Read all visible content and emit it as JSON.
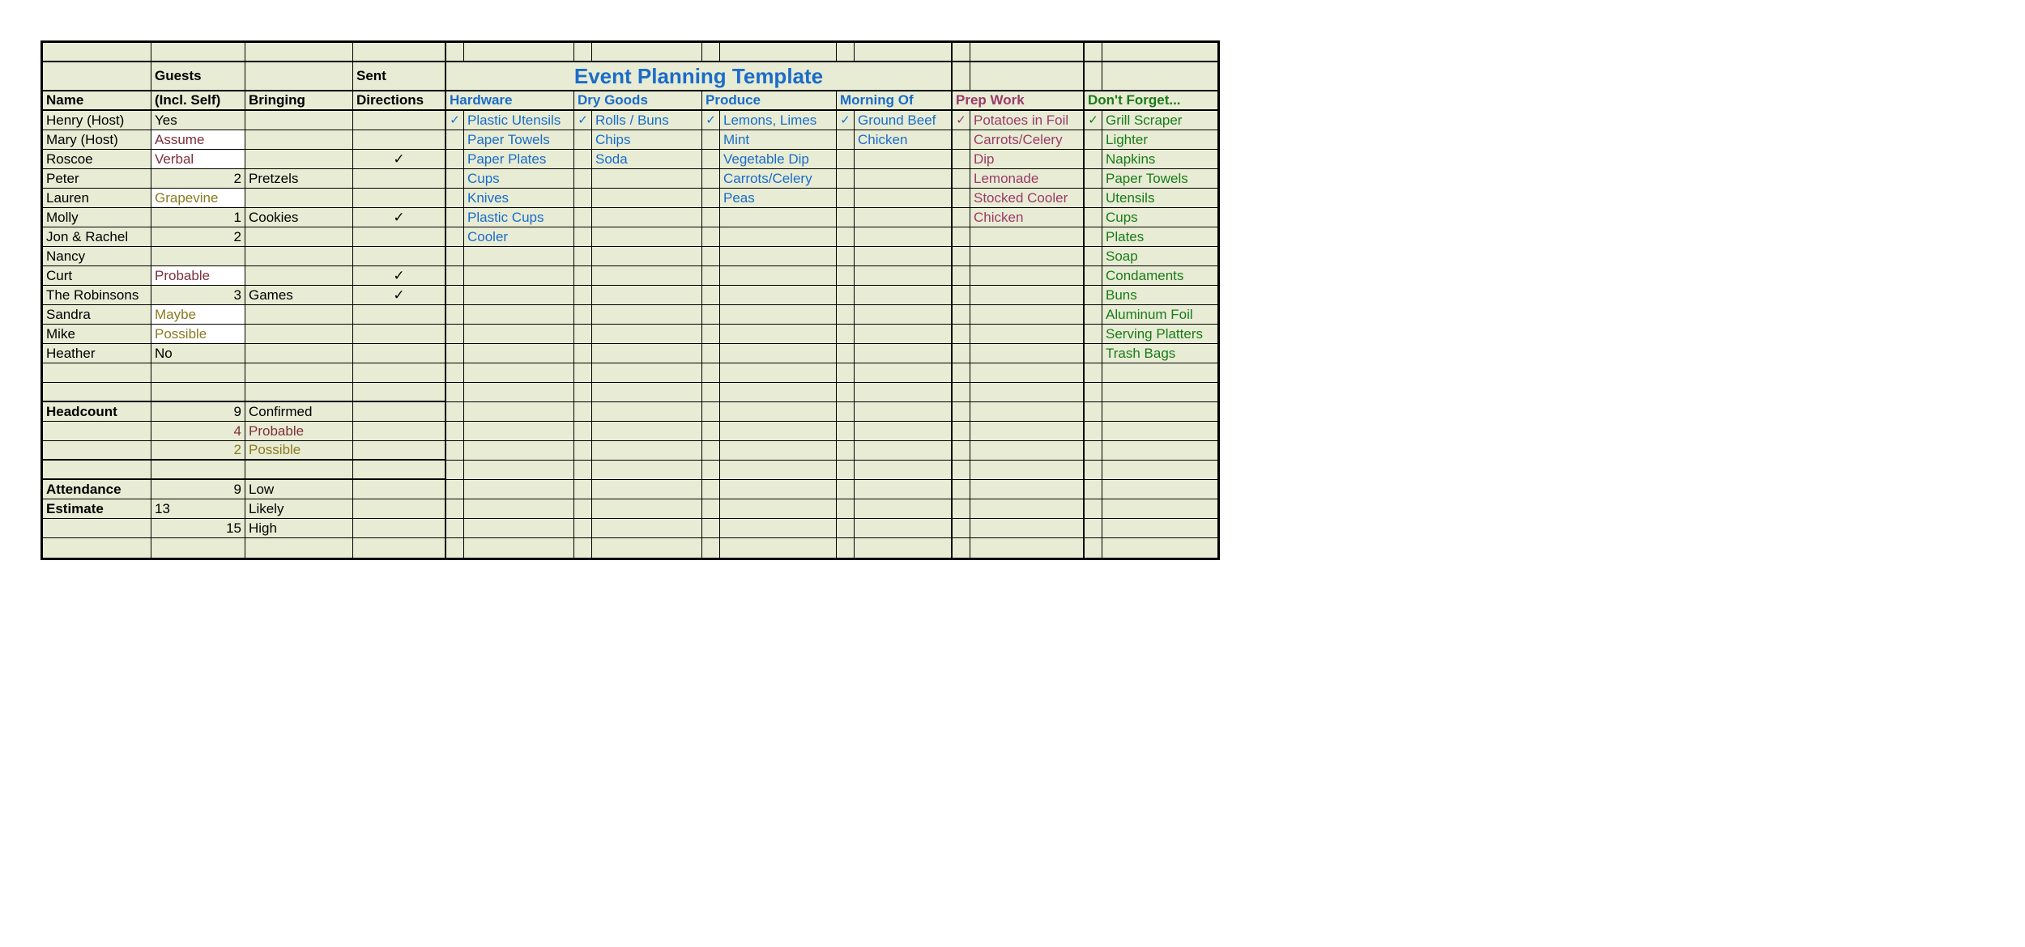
{
  "title": "Event Planning Template",
  "headers": {
    "guests": "Guests",
    "sent": "Sent",
    "name": "Name",
    "incl_self": "(Incl. Self)",
    "bringing": "Bringing",
    "directions": "Directions",
    "hardware": "Hardware",
    "dry_goods": "Dry Goods",
    "produce": "Produce",
    "morning_of": "Morning Of",
    "prep_work": "Prep Work",
    "dont_forget": "Don't Forget..."
  },
  "guests": [
    {
      "name": "Henry (Host)",
      "incl": "Yes",
      "incl_style": "",
      "bringing": "",
      "dir": ""
    },
    {
      "name": "Mary (Host)",
      "incl": "Assume",
      "incl_style": "maroon white",
      "bringing": "",
      "dir": ""
    },
    {
      "name": "Roscoe",
      "incl": "Verbal",
      "incl_style": "maroon white",
      "bringing": "",
      "dir": "✓"
    },
    {
      "name": "Peter",
      "incl": "2",
      "incl_style": "right",
      "bringing": "Pretzels",
      "dir": ""
    },
    {
      "name": "Lauren",
      "incl": "Grapevine",
      "incl_style": "olive white",
      "bringing": "",
      "dir": ""
    },
    {
      "name": "Molly",
      "incl": "1",
      "incl_style": "right",
      "bringing": "Cookies",
      "dir": "✓"
    },
    {
      "name": "Jon & Rachel",
      "incl": "2",
      "incl_style": "right",
      "bringing": "",
      "dir": ""
    },
    {
      "name": "Nancy",
      "incl": "",
      "incl_style": "",
      "bringing": "",
      "dir": ""
    },
    {
      "name": "Curt",
      "incl": "Probable",
      "incl_style": "maroon white",
      "bringing": "",
      "dir": "✓"
    },
    {
      "name": "The Robinsons",
      "incl": "3",
      "incl_style": "right",
      "bringing": "Games",
      "dir": "✓"
    },
    {
      "name": "Sandra",
      "incl": "Maybe",
      "incl_style": "olive white",
      "bringing": "",
      "dir": ""
    },
    {
      "name": "Mike",
      "incl": "Possible",
      "incl_style": "olive white",
      "bringing": "",
      "dir": ""
    },
    {
      "name": "Heather",
      "incl": "No",
      "incl_style": "",
      "bringing": "",
      "dir": ""
    }
  ],
  "hardware": [
    "Plastic Utensils",
    "Paper Towels",
    "Paper Plates",
    "Cups",
    "Knives",
    "Plastic Cups",
    "Cooler",
    "",
    "",
    "",
    "",
    "",
    ""
  ],
  "dry_goods": [
    "Rolls / Buns",
    "Chips",
    "Soda",
    "",
    "",
    "",
    "",
    "",
    "",
    "",
    "",
    "",
    ""
  ],
  "produce": [
    "Lemons, Limes",
    "Mint",
    "Vegetable Dip",
    "Carrots/Celery",
    "Peas",
    "",
    "",
    "",
    "",
    "",
    "",
    "",
    ""
  ],
  "morning_of": [
    "Ground Beef",
    "Chicken",
    "",
    "",
    "",
    "",
    "",
    "",
    "",
    "",
    "",
    "",
    ""
  ],
  "prep_work": [
    "Potatoes in Foil",
    "Carrots/Celery",
    "Dip",
    "Lemonade",
    "Stocked Cooler",
    "Chicken",
    "",
    "",
    "",
    "",
    "",
    "",
    ""
  ],
  "dont_forget": [
    "Grill Scraper",
    "Lighter",
    "Napkins",
    "Paper Towels",
    "Utensils",
    "Cups",
    "Plates",
    "Soap",
    "Condaments",
    "Buns",
    "Aluminum Foil",
    "Serving Platters",
    "Trash Bags"
  ],
  "checks": {
    "hardware": "✓",
    "dry_goods": "✓",
    "produce": "✓",
    "morning_of": "✓",
    "prep_work": "✓",
    "dont_forget": "✓"
  },
  "summary": {
    "headcount_label": "Headcount",
    "headcount_n": "9",
    "headcount_t": "Confirmed",
    "probable_n": "4",
    "probable_t": "Probable",
    "possible_n": "2",
    "possible_t": "Possible",
    "attendance_label": "Attendance",
    "estimate_label": "Estimate",
    "low_n": "9",
    "low_t": "Low",
    "likely_n": "13",
    "likely_t": "Likely",
    "high_n": "15",
    "high_t": "High"
  }
}
